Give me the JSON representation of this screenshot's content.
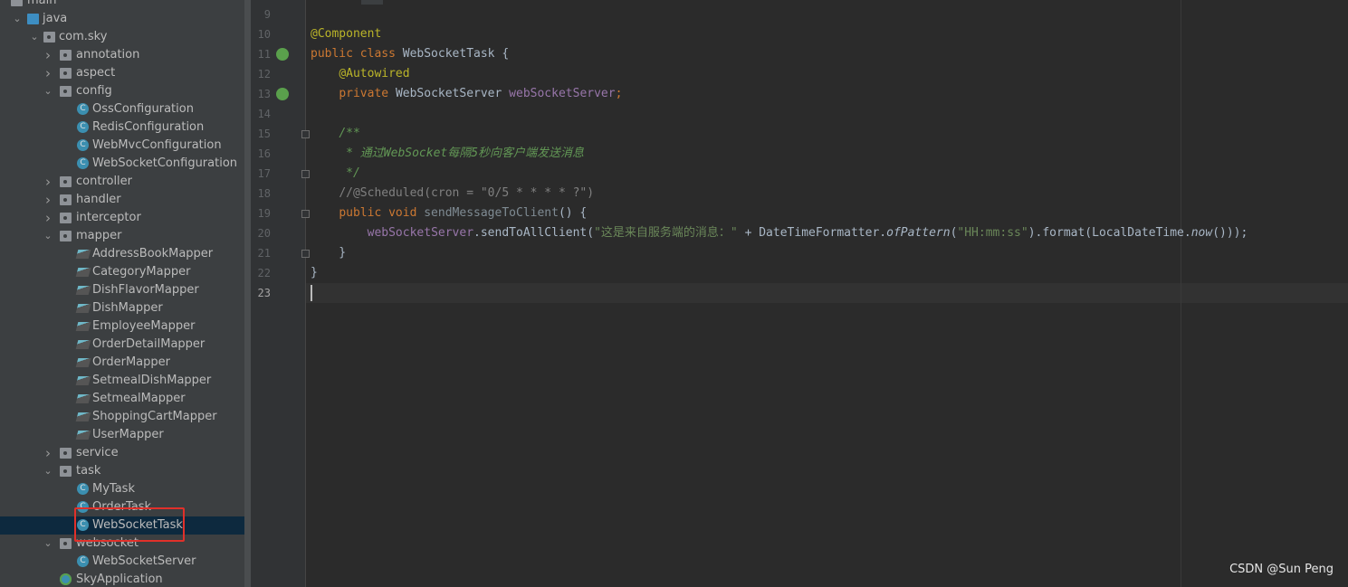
{
  "tree": [
    {
      "label": "main",
      "level": 1,
      "kind": "folder",
      "arrow": ""
    },
    {
      "label": "java",
      "level": 1,
      "kind": "folder-blue",
      "arrow": "open"
    },
    {
      "label": "com.sky",
      "level": 2,
      "kind": "package",
      "arrow": "open"
    },
    {
      "label": "annotation",
      "level": 3,
      "kind": "package",
      "arrow": "closed"
    },
    {
      "label": "aspect",
      "level": 3,
      "kind": "package",
      "arrow": "closed"
    },
    {
      "label": "config",
      "level": 3,
      "kind": "package",
      "arrow": "open"
    },
    {
      "label": "OssConfiguration",
      "level": 4,
      "kind": "class"
    },
    {
      "label": "RedisConfiguration",
      "level": 4,
      "kind": "class"
    },
    {
      "label": "WebMvcConfiguration",
      "level": 4,
      "kind": "class"
    },
    {
      "label": "WebSocketConfiguration",
      "level": 4,
      "kind": "class"
    },
    {
      "label": "controller",
      "level": 3,
      "kind": "package",
      "arrow": "closed"
    },
    {
      "label": "handler",
      "level": 3,
      "kind": "package",
      "arrow": "closed"
    },
    {
      "label": "interceptor",
      "level": 3,
      "kind": "package",
      "arrow": "closed"
    },
    {
      "label": "mapper",
      "level": 3,
      "kind": "package",
      "arrow": "open"
    },
    {
      "label": "AddressBookMapper",
      "level": 4,
      "kind": "mapper"
    },
    {
      "label": "CategoryMapper",
      "level": 4,
      "kind": "mapper"
    },
    {
      "label": "DishFlavorMapper",
      "level": 4,
      "kind": "mapper"
    },
    {
      "label": "DishMapper",
      "level": 4,
      "kind": "mapper"
    },
    {
      "label": "EmployeeMapper",
      "level": 4,
      "kind": "mapper"
    },
    {
      "label": "OrderDetailMapper",
      "level": 4,
      "kind": "mapper"
    },
    {
      "label": "OrderMapper",
      "level": 4,
      "kind": "mapper"
    },
    {
      "label": "SetmealDishMapper",
      "level": 4,
      "kind": "mapper"
    },
    {
      "label": "SetmealMapper",
      "level": 4,
      "kind": "mapper"
    },
    {
      "label": "ShoppingCartMapper",
      "level": 4,
      "kind": "mapper"
    },
    {
      "label": "UserMapper",
      "level": 4,
      "kind": "mapper"
    },
    {
      "label": "service",
      "level": 3,
      "kind": "package",
      "arrow": "closed"
    },
    {
      "label": "task",
      "level": 3,
      "kind": "package",
      "arrow": "open"
    },
    {
      "label": "MyTask",
      "level": 4,
      "kind": "class"
    },
    {
      "label": "OrderTask",
      "level": 4,
      "kind": "class"
    },
    {
      "label": "WebSocketTask",
      "level": 4,
      "kind": "class",
      "selected": true
    },
    {
      "label": "websocket",
      "level": 3,
      "kind": "package",
      "arrow": "open"
    },
    {
      "label": "WebSocketServer",
      "level": 4,
      "kind": "class"
    },
    {
      "label": "SkyApplication",
      "level": 3,
      "kind": "app"
    }
  ],
  "editor": {
    "line_numbers": [
      "9",
      "10",
      "11",
      "12",
      "13",
      "14",
      "15",
      "16",
      "17",
      "18",
      "19",
      "20",
      "21",
      "22",
      "23"
    ],
    "current_line": "23",
    "lines": [
      [],
      [
        [
          "ann",
          "@Component"
        ]
      ],
      [
        [
          "kw",
          "public class "
        ],
        [
          "",
          "WebSocketTask {"
        ]
      ],
      [
        [
          "",
          "    "
        ],
        [
          "ann",
          "@Autowired"
        ]
      ],
      [
        [
          "",
          "    "
        ],
        [
          "kw",
          "private "
        ],
        [
          "",
          "WebSocketServer "
        ],
        [
          "fld",
          "webSocketServer"
        ],
        [
          "kw",
          ";"
        ]
      ],
      [],
      [
        [
          "",
          "    "
        ],
        [
          "doc",
          "/**"
        ]
      ],
      [
        [
          "",
          "     "
        ],
        [
          "doc",
          "* 通过WebSocket每隔5秒向客户端发送消息"
        ]
      ],
      [
        [
          "",
          "     "
        ],
        [
          "doc",
          "*/"
        ]
      ],
      [
        [
          "",
          "    "
        ],
        [
          "cm",
          "//@Scheduled(cron = \"0/5 * * * * ?\")"
        ]
      ],
      [
        [
          "",
          "    "
        ],
        [
          "kw",
          "public void "
        ],
        [
          "unused",
          "sendMessageToClient"
        ],
        [
          "",
          "() {"
        ]
      ],
      [
        [
          "",
          "        "
        ],
        [
          "fld",
          "webSocketServer"
        ],
        [
          "",
          ".sendToAllClient("
        ],
        [
          "str",
          "\"这是来自服务端的消息：\""
        ],
        [
          "",
          " + DateTimeFormatter."
        ],
        [
          "it",
          "ofPattern"
        ],
        [
          "",
          "("
        ],
        [
          "str",
          "\"HH:mm:ss\""
        ],
        [
          "",
          ").format(LocalDateTime."
        ],
        [
          "it",
          "now"
        ],
        [
          "",
          "()));"
        ]
      ],
      [
        [
          "",
          "    }"
        ]
      ],
      [
        [
          "",
          "}"
        ]
      ],
      []
    ]
  },
  "watermark": "CSDN @Sun  Peng",
  "colors": {
    "sidebar_bg": "#3c3f41",
    "editor_bg": "#2b2b2b",
    "selection": "#0d293e",
    "highlight_box": "#e0302a"
  }
}
